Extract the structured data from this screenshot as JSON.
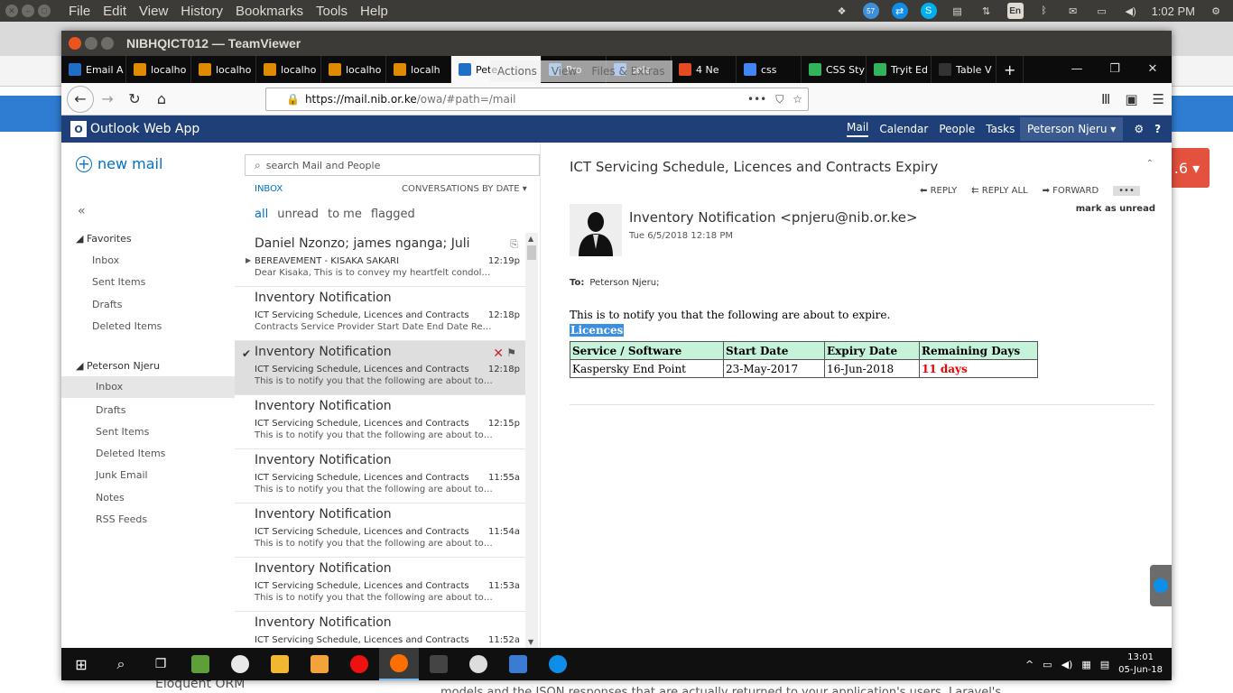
{
  "ubuntu_panel": {
    "menus": [
      "File",
      "Edit",
      "View",
      "History",
      "Bookmarks",
      "Tools",
      "Help"
    ],
    "battery_badge": "57",
    "lang": "En",
    "time": "1:02 PM"
  },
  "outer": {
    "right_button": ".6 ▾",
    "bottom_text": "Eloquent ORM",
    "bottom_text2": "models and the JSON responses that are actually returned to your application's users. Laravel's"
  },
  "teamviewer": {
    "title": "NIBHQICT012 — TeamViewer",
    "float_bar": [
      "Actions",
      "View",
      "Files & Extras"
    ]
  },
  "firefox": {
    "tabs": [
      {
        "label": "Email A",
        "color": "#1f6fc6"
      },
      {
        "label": "localho",
        "color": "#e08a00"
      },
      {
        "label": "localho",
        "color": "#e08a00"
      },
      {
        "label": "localho",
        "color": "#e08a00"
      },
      {
        "label": "localho",
        "color": "#e08a00"
      },
      {
        "label": "localh",
        "color": "#e08a00"
      },
      {
        "label": "Pete",
        "color": "#1f6fc6"
      },
      {
        "label": "Pro",
        "color": "#4a90d9"
      },
      {
        "label": "sele",
        "color": "#4285f4"
      },
      {
        "label": "4 Ne",
        "color": "#e44b23"
      },
      {
        "label": "css",
        "color": "#4285f4"
      },
      {
        "label": "CSS Sty",
        "color": "#31b45c"
      },
      {
        "label": "Tryit Ed",
        "color": "#31b45c"
      },
      {
        "label": "Table V",
        "color": "#333333"
      }
    ],
    "url_domain": "https://mail.nib.or.ke",
    "url_path": "/owa/#path=/mail"
  },
  "owa": {
    "app_name": "Outlook Web App",
    "nav": [
      "Mail",
      "Calendar",
      "People",
      "Tasks"
    ],
    "user": "Peterson Njeru",
    "new_mail": "new mail",
    "collapse": "«",
    "favorites_label": "Favorites",
    "favorites": [
      "Inbox",
      "Sent Items",
      "Drafts",
      "Deleted Items"
    ],
    "account_label": "Peterson Njeru",
    "folders": [
      "Inbox",
      "Drafts",
      "Sent Items",
      "Deleted Items",
      "Junk Email",
      "Notes",
      "RSS Feeds"
    ],
    "search_placeholder": "search Mail and People",
    "inbox_label": "INBOX",
    "conv_label": "CONVERSATIONS BY DATE",
    "filters": [
      "all",
      "unread",
      "to me",
      "flagged"
    ],
    "messages": [
      {
        "from": "Daniel Nzonzo; james nganga; Juli",
        "subject": "BEREAVEMENT - KISAKA SAKARI",
        "preview": "Dear Kisaka, This is to convey my heartfelt condolenc...",
        "time": "12:19p"
      },
      {
        "from": "Inventory Notification",
        "subject": "ICT Servicing Schedule, Licences and Contracts",
        "preview": "Contracts Service Provider Start Date End Date Rema...",
        "time": "12:18p"
      },
      {
        "from": "Inventory Notification",
        "subject": "ICT Servicing Schedule, Licences and Contracts",
        "preview": "This is to notify you that the following are about to e...",
        "time": "12:18p"
      },
      {
        "from": "Inventory Notification",
        "subject": "ICT Servicing Schedule, Licences and Contracts",
        "preview": "This is to notify you that the following are about to e...",
        "time": "12:15p"
      },
      {
        "from": "Inventory Notification",
        "subject": "ICT Servicing Schedule, Licences and Contracts",
        "preview": "This is to notify you that the following are about to e...",
        "time": "11:55a"
      },
      {
        "from": "Inventory Notification",
        "subject": "ICT Servicing Schedule, Licences and Contracts",
        "preview": "This is to notify you that the following are about to e...",
        "time": "11:54a"
      },
      {
        "from": "Inventory Notification",
        "subject": "ICT Servicing Schedule, Licences and Contracts",
        "preview": "This is to notify you that the following are about to e...",
        "time": "11:53a"
      },
      {
        "from": "Inventory Notification",
        "subject": "ICT Servicing Schedule, Licences and Contracts",
        "preview": "",
        "time": "11:52a"
      }
    ],
    "reading": {
      "subject": "ICT Servicing Schedule, Licences and Contracts Expiry",
      "reply": "REPLY",
      "reply_all": "REPLY ALL",
      "forward": "FORWARD",
      "more": "•••",
      "sender": "Inventory Notification <pnjeru@nib.or.ke>",
      "date": "Tue 6/5/2018 12:18 PM",
      "mark_unread": "mark as unread",
      "to_label": "To:",
      "to_value": "Peterson Njeru;",
      "body_intro": "This is to notify you that the following are about to expire.",
      "section": "Licences",
      "table_headers": [
        "Service / Software",
        "Start Date",
        "Expiry Date",
        "Remaining Days"
      ],
      "table_rows": [
        [
          "Kaspersky End Point",
          "23-May-2017",
          "16-Jun-2018",
          "11 days"
        ]
      ]
    }
  },
  "taskbar": {
    "apps": [
      "#5f9f3a",
      "#e8e8e8",
      "#f2b632",
      "#f2a33a",
      "#e11",
      "#ff6f00",
      "#444",
      "#ddd",
      "#3c7bd4",
      "#0e8ee9"
    ],
    "time": "13:01",
    "date": "05-Jun-18"
  }
}
